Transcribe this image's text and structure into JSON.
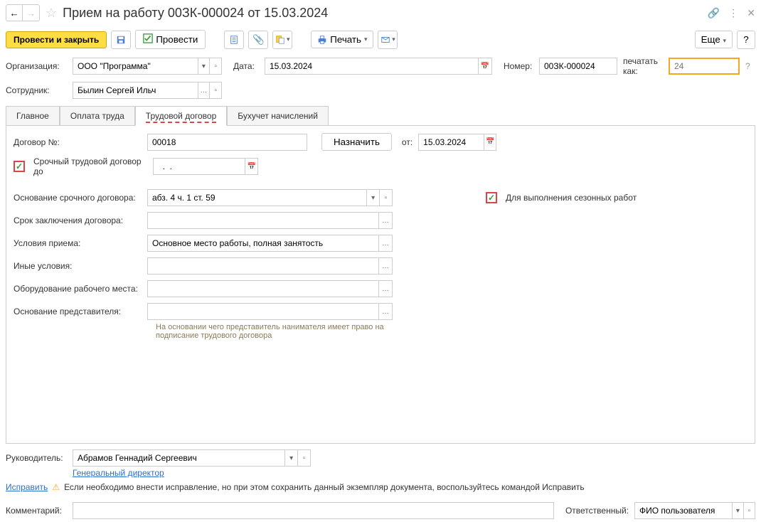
{
  "header": {
    "title": "Прием на работу 00ЗК-000024 от 15.03.2024"
  },
  "toolbar": {
    "post_close": "Провести и закрыть",
    "post": "Провести",
    "print": "Печать",
    "more": "Еще"
  },
  "top_form": {
    "org_label": "Организация:",
    "org_value": "ООО \"Программа\"",
    "date_label": "Дата:",
    "date_value": "15.03.2024",
    "number_label": "Номер:",
    "number_value": "00ЗК-000024",
    "print_as_label": "печатать как:",
    "print_as_placeholder": "24",
    "employee_label": "Сотрудник:",
    "employee_value": "Былин Сергей Ильч"
  },
  "tabs": [
    {
      "label": "Главное"
    },
    {
      "label": "Оплата труда"
    },
    {
      "label": "Трудовой договор"
    },
    {
      "label": "Бухучет начислений"
    }
  ],
  "contract": {
    "number_label": "Договор №:",
    "number_value": "00018",
    "assign": "Назначить",
    "from_label": "от:",
    "from_date": "15.03.2024",
    "urgent_label": "Срочный трудовой договор до",
    "urgent_date": "  .  .    ",
    "basis_label": "Основание срочного договора:",
    "basis_value": "абз. 4 ч. 1 ст. 59",
    "seasonal_label": "Для выполнения сезонных работ",
    "term_label": "Срок заключения договора:",
    "term_value": "",
    "conditions_label": "Условия приема:",
    "conditions_value": "Основное место работы, полная занятость",
    "other_label": "Иные условия:",
    "other_value": "",
    "equipment_label": "Оборудование рабочего места:",
    "equipment_value": "",
    "rep_basis_label": "Основание представителя:",
    "rep_basis_value": "",
    "rep_hint": "На основании чего представитель нанимателя имеет право на подписание трудового договора"
  },
  "bottom": {
    "leader_label": "Руководитель:",
    "leader_value": "Абрамов Геннадий Сергеевич",
    "leader_position": "Генеральный директор",
    "fix_link": "Исправить",
    "warning_text": "Если необходимо внести исправление, но при этом сохранить данный экземпляр документа, воспользуйтесь командой Исправить",
    "comment_label": "Комментарий:",
    "comment_value": "",
    "responsible_label": "Ответственный:",
    "responsible_value": "ФИО пользователя"
  }
}
